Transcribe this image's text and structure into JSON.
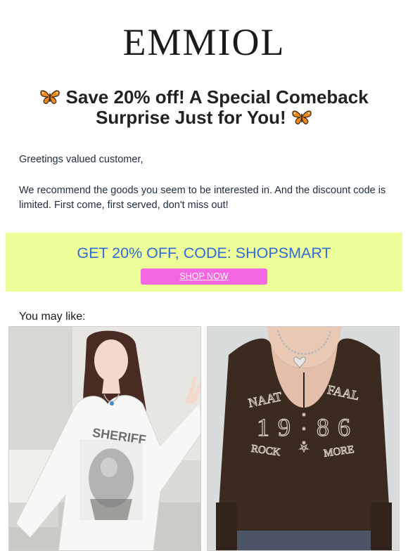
{
  "brand": {
    "logo_text": "EMMIOL"
  },
  "headline": {
    "line1": "Save 20% off! A Special Comeback",
    "line2": "Surprise Just for You!",
    "icon": "butterfly-icon"
  },
  "greeting": "Greetings valued customer,",
  "intro": "We recommend the goods you seem to be interested in. And the discount code is limited. First come, first served, don't miss out!",
  "promo": {
    "code_text": "GET 20% OFF, CODE: SHOPSMART",
    "button_label": "SHOP NOW",
    "background": "#eeff99",
    "code_color": "#2f6bd6",
    "button_color": "#f466e2"
  },
  "recommend": {
    "heading": "You may like:",
    "products": [
      {
        "image": "white oversized graphic long-sleeve tee photo",
        "print_text": "SHERIFF"
      },
      {
        "image": "brown henley long-sleeve top photo",
        "print_left": "NAAT",
        "print_right": "FAAL",
        "year_digits": [
          "1",
          "9",
          "8",
          "6"
        ],
        "print_bottom_left": "ROCK",
        "print_bottom_right": "MORE"
      }
    ]
  }
}
